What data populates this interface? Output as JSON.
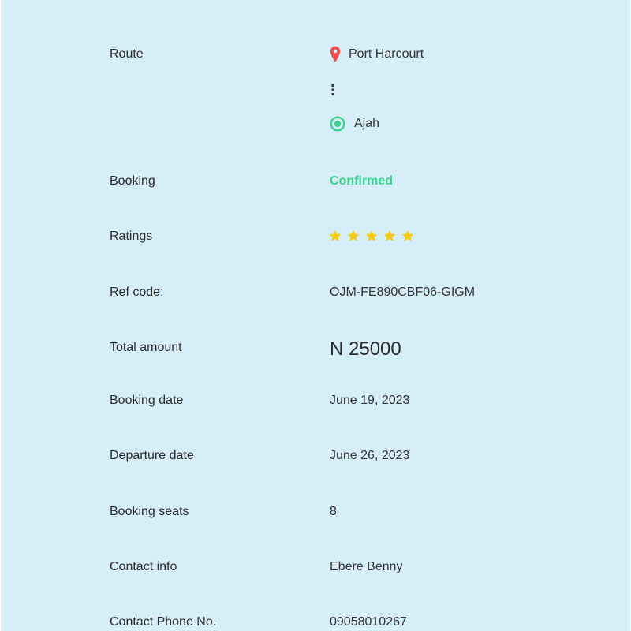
{
  "booking_details": {
    "route": {
      "label": "Route",
      "origin": "Port Harcourt",
      "destination": "Ajah",
      "origin_icon": "map-pin-icon",
      "destination_icon": "target-circle-icon",
      "origin_icon_color": "#ef4b4b",
      "destination_icon_color": "#3ecf8e"
    },
    "booking": {
      "label": "Booking",
      "status": "Confirmed",
      "status_color": "#3ecf8e"
    },
    "ratings": {
      "label": "Ratings",
      "stars": 5,
      "max_stars": 5,
      "star_color": "#f7cb15"
    },
    "ref_code": {
      "label": "Ref code:",
      "value": "OJM-FE890CBF06-GIGM"
    },
    "total_amount": {
      "label": "Total amount",
      "value": "N 25000"
    },
    "booking_date": {
      "label": "Booking date",
      "value": "June 19, 2023"
    },
    "departure_date": {
      "label": "Departure date",
      "value": "June 26, 2023"
    },
    "booking_seats": {
      "label": "Booking seats",
      "value": "8"
    },
    "contact_info": {
      "label": "Contact info",
      "value": "Ebere Benny"
    },
    "contact_phone": {
      "label": "Contact Phone No.",
      "value": "09058010267"
    }
  }
}
